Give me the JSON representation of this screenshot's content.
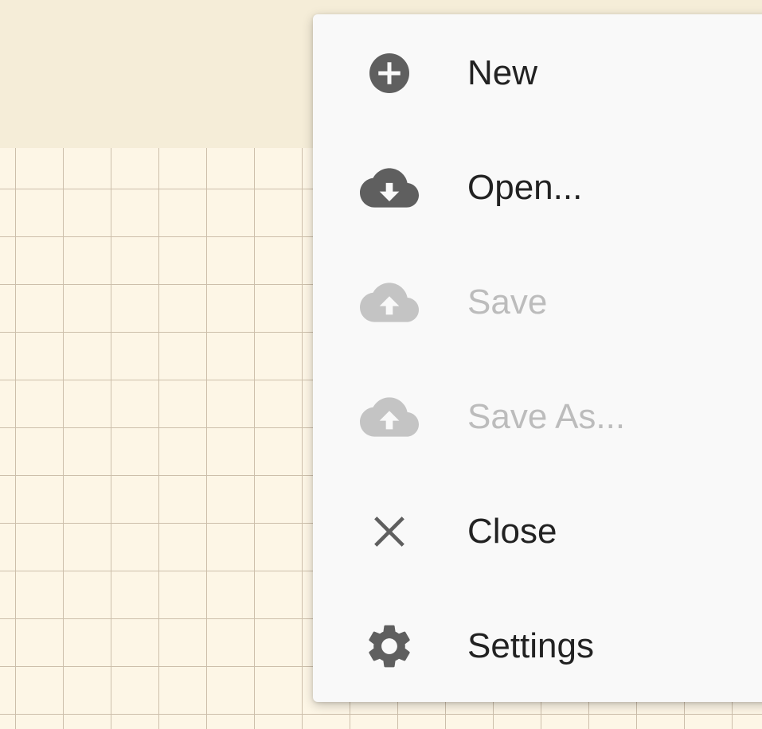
{
  "colors": {
    "icon_active": "#5f5f5f",
    "icon_disabled": "#c4c4c4",
    "text_active": "#222222",
    "text_disabled": "#bcbcbc",
    "menu_background": "#f9f9f9",
    "canvas_background": "#fdf6e6",
    "grid_line": "#cdbfab"
  },
  "menu": {
    "items": [
      {
        "label": "New",
        "icon": "add-circle-icon",
        "enabled": true
      },
      {
        "label": "Open...",
        "icon": "cloud-download-icon",
        "enabled": true
      },
      {
        "label": "Save",
        "icon": "cloud-upload-icon",
        "enabled": false
      },
      {
        "label": "Save As...",
        "icon": "cloud-upload-icon",
        "enabled": false
      },
      {
        "label": "Close",
        "icon": "close-icon",
        "enabled": true
      },
      {
        "label": "Settings",
        "icon": "gear-icon",
        "enabled": true
      }
    ]
  }
}
